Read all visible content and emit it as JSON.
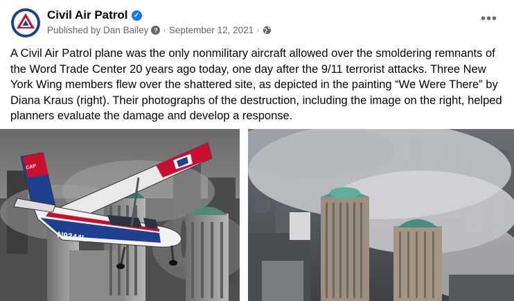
{
  "post": {
    "page_name": "Civil Air Patrol",
    "published_by": "Published by Dan Bailey",
    "separator": "·",
    "date": "September 12, 2021",
    "body": "A Civil Air Patrol plane was the only nonmilitary aircraft allowed over the smoldering remnants of the Word Trade Center 20 years ago today, one day after the 9/11 terrorist attacks. Three New York Wing members flew over the shattered site, as depicted in the painting “We Were There” by Diana Kraus (right). Their photographs of the destruction, including the image on the right, helped planners evaluate the damage and  develop a response.",
    "more_label": "•••"
  },
  "images": {
    "painting_tail_text": "CAP",
    "painting_registration": "N9344L"
  },
  "colors": {
    "verified_blue": "#1877f2",
    "meta_gray": "#65676b",
    "cap_red": "#c8102e",
    "cap_blue": "#1f3f8f"
  }
}
